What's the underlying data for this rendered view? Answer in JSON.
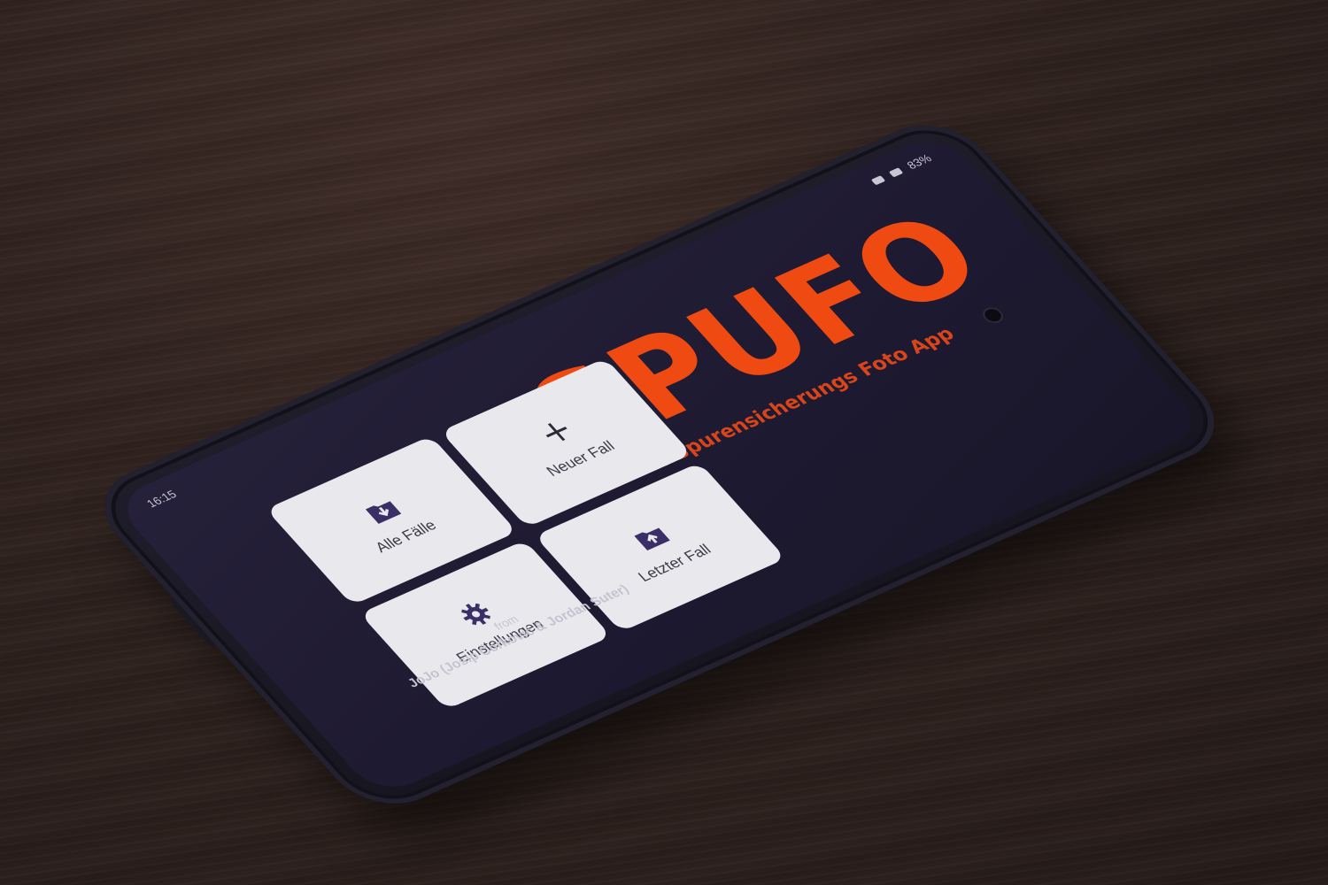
{
  "status_bar": {
    "time": "16:15",
    "battery": "83%"
  },
  "brand": {
    "title": "SPUFO",
    "subtitle": "Die Spurensicherungs Foto App"
  },
  "tiles": [
    {
      "label": "Alle Fälle",
      "icon": "folder-download-icon"
    },
    {
      "label": "Neuer Fall",
      "icon": "plus-icon"
    },
    {
      "label": "Einstellungen",
      "icon": "gear-icon"
    },
    {
      "label": "Letzter Fall",
      "icon": "folder-upload-icon"
    }
  ],
  "credits": {
    "from": "from",
    "names": "JoJo (Josip Ćorković & Jordan Suter)"
  },
  "colors": {
    "brand": "#ef4a12",
    "screen_bg": "#1d1930",
    "tile_bg": "#e9e8ec",
    "icon": "#3a2f66"
  }
}
